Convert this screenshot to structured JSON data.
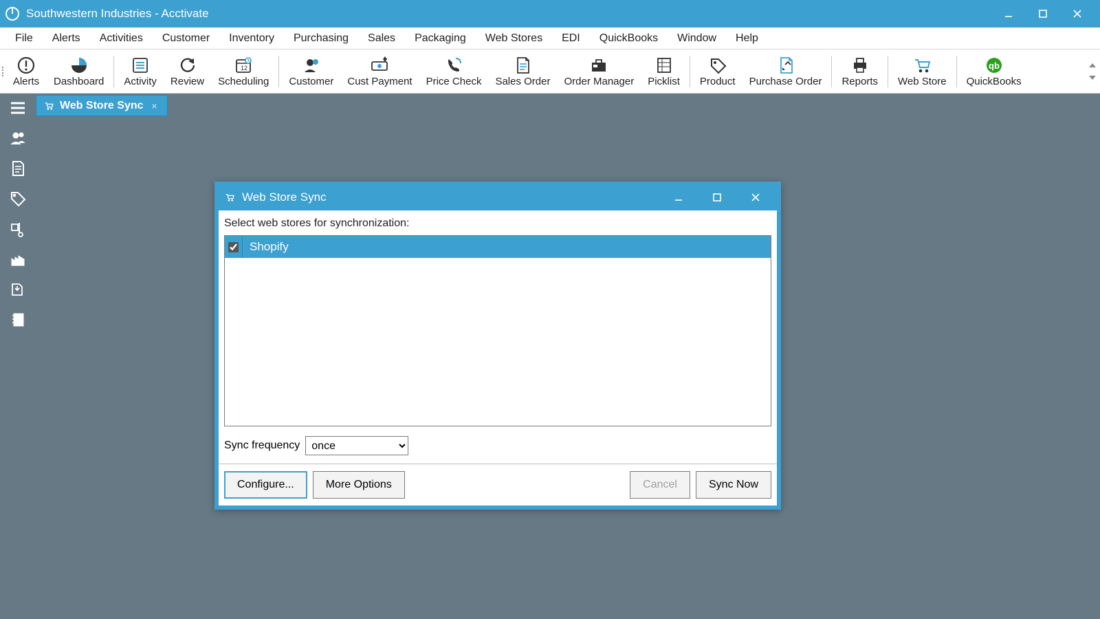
{
  "window": {
    "title": "Southwestern Industries - Acctivate"
  },
  "menu": {
    "items": [
      "File",
      "Alerts",
      "Activities",
      "Customer",
      "Inventory",
      "Purchasing",
      "Sales",
      "Packaging",
      "Web Stores",
      "EDI",
      "QuickBooks",
      "Window",
      "Help"
    ]
  },
  "toolbar": {
    "groups": [
      [
        "Alerts",
        "Dashboard"
      ],
      [
        "Activity",
        "Review",
        "Scheduling"
      ],
      [
        "Customer",
        "Cust Payment",
        "Price Check",
        "Sales Order",
        "Order Manager",
        "Picklist"
      ],
      [
        "Product",
        "Purchase Order"
      ],
      [
        "Reports"
      ],
      [
        "Web Store"
      ],
      [
        "QuickBooks"
      ]
    ]
  },
  "tabs": {
    "active": "Web Store Sync"
  },
  "dialog": {
    "title": "Web Store Sync",
    "prompt": "Select web stores for synchronization:",
    "stores": [
      {
        "name": "Shopify",
        "checked": true,
        "selected": true
      }
    ],
    "freq_label": "Sync frequency",
    "freq_value": "once",
    "buttons": {
      "configure": "Configure...",
      "more": "More Options",
      "cancel": "Cancel",
      "sync": "Sync Now"
    }
  }
}
